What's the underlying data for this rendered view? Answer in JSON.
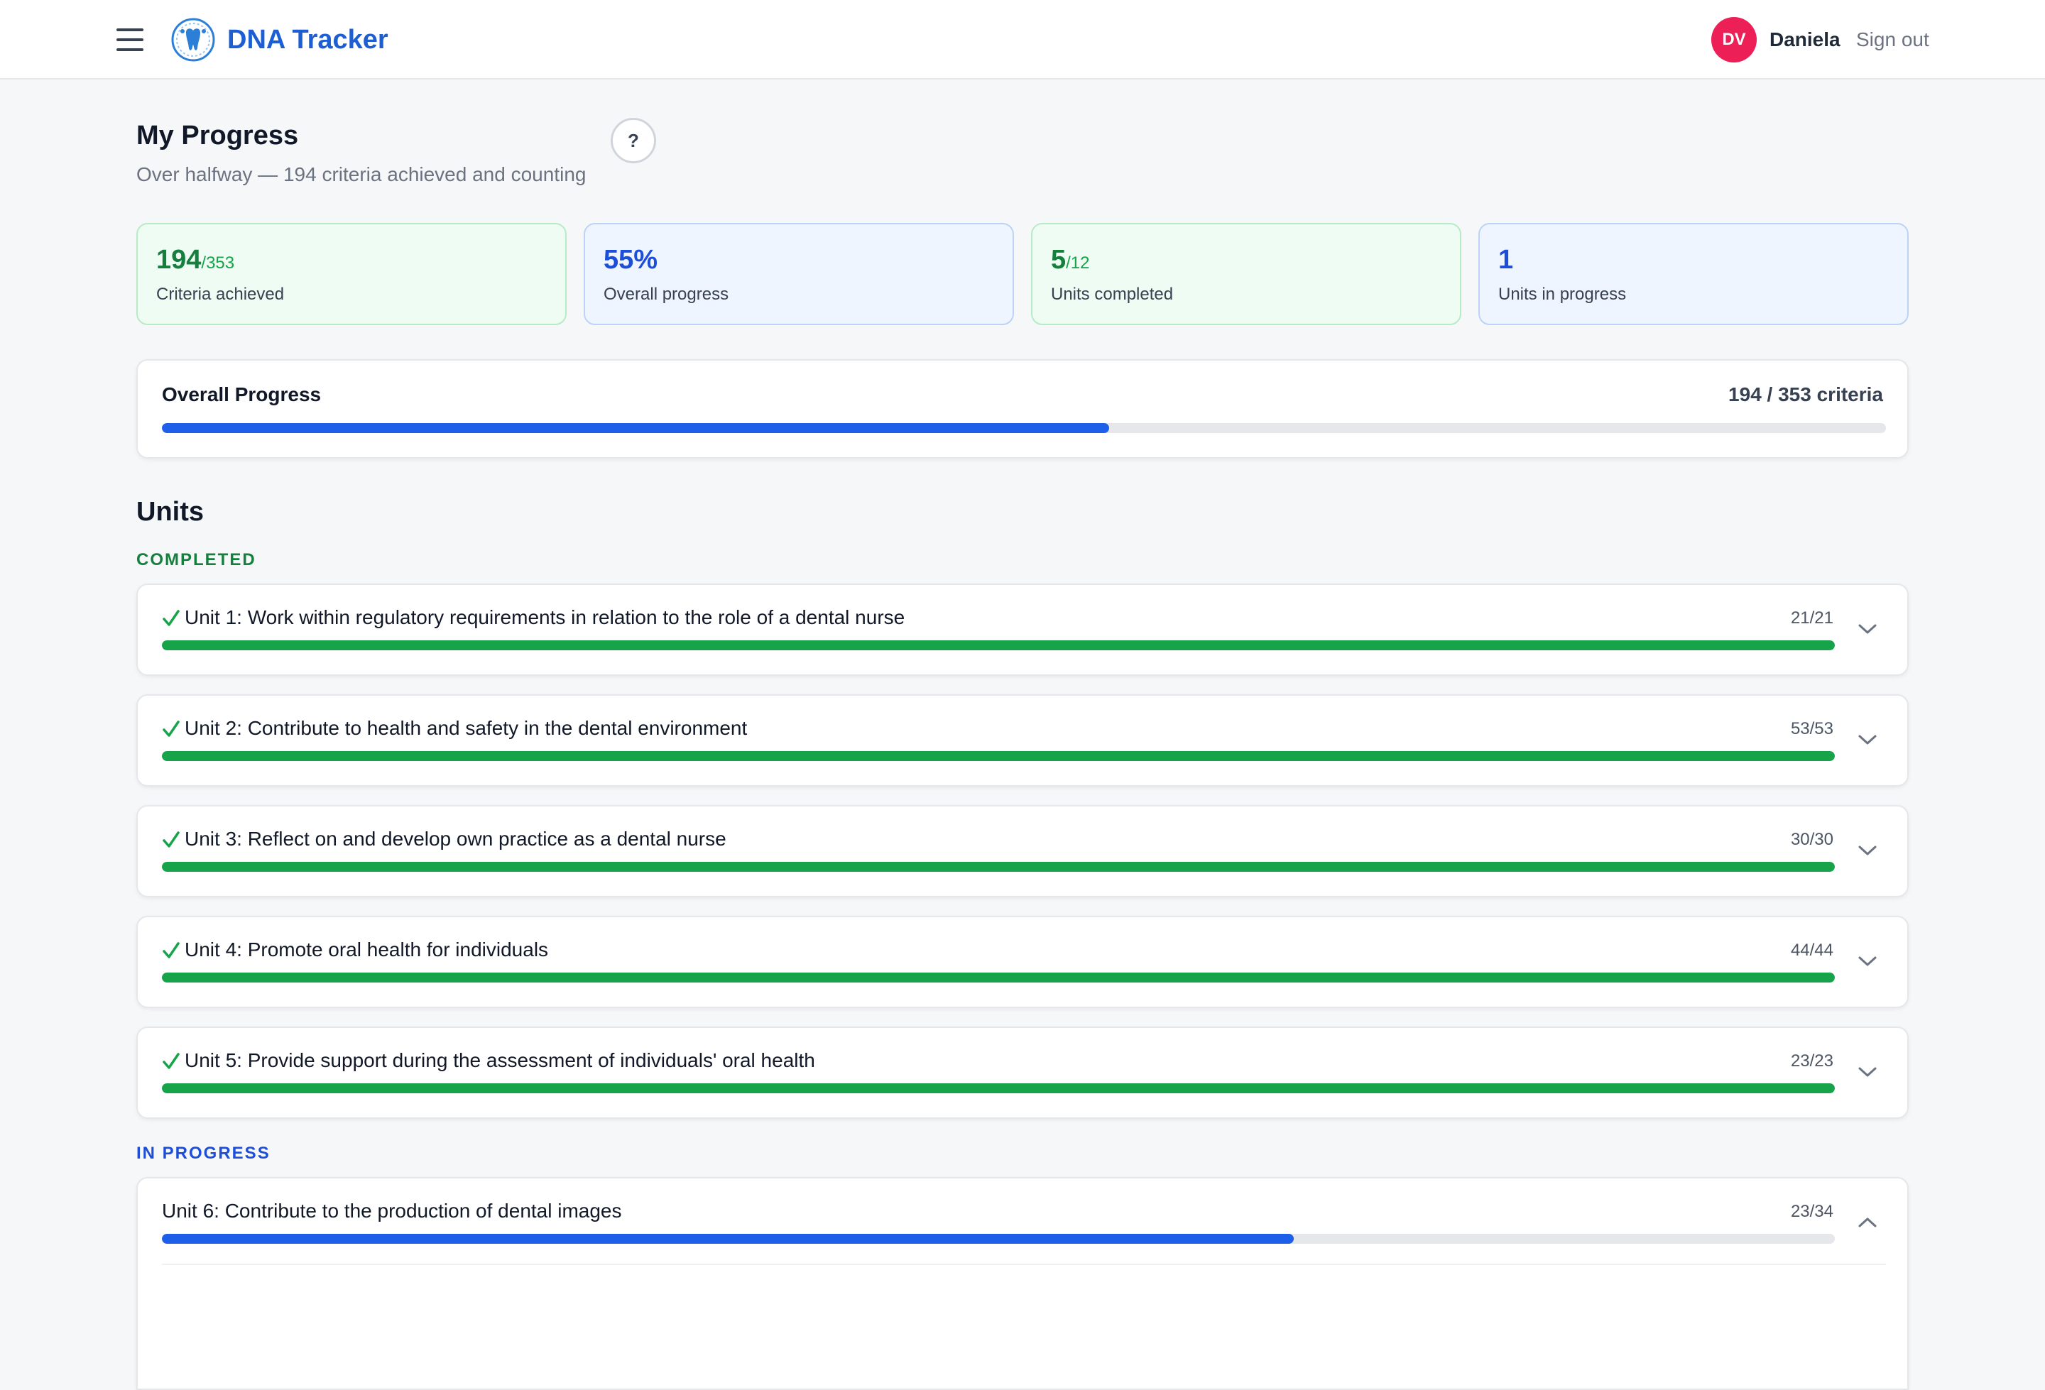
{
  "header": {
    "brand": "DNA Tracker",
    "logo_icon": "tooth-logo-icon",
    "menu_icon": "hamburger-icon",
    "user": {
      "initials": "DV",
      "name": "Daniela",
      "avatar_color": "#ec1f57"
    },
    "sign_out_label": "Sign out"
  },
  "page": {
    "title": "My Progress",
    "subtitle": "Over halfway — 194 criteria achieved and counting",
    "help_label": "?"
  },
  "stats": [
    {
      "value": "194",
      "suffix": "/353",
      "label": "Criteria achieved",
      "tone": "green"
    },
    {
      "value": "55%",
      "suffix": "",
      "label": "Overall progress",
      "tone": "blue"
    },
    {
      "value": "5",
      "suffix": "/12",
      "label": "Units completed",
      "tone": "green"
    },
    {
      "value": "1",
      "suffix": "",
      "label": "Units in progress",
      "tone": "blue"
    }
  ],
  "overall": {
    "title": "Overall Progress",
    "count_label": "194 / 353 criteria",
    "achieved": 194,
    "total": 353
  },
  "units": {
    "title": "Units",
    "completed_label": "COMPLETED",
    "in_progress_label": "IN PROGRESS",
    "completed": [
      {
        "title": "Unit 1: Work within regulatory requirements in relation to the role of a dental nurse",
        "count": "21/21",
        "done": 21,
        "total": 21
      },
      {
        "title": "Unit 2: Contribute to health and safety in the dental environment",
        "count": "53/53",
        "done": 53,
        "total": 53
      },
      {
        "title": "Unit 3: Reflect on and develop own practice as a dental nurse",
        "count": "30/30",
        "done": 30,
        "total": 30
      },
      {
        "title": "Unit 4: Promote oral health for individuals",
        "count": "44/44",
        "done": 44,
        "total": 44
      },
      {
        "title": "Unit 5: Provide support during the assessment of individuals' oral health",
        "count": "23/23",
        "done": 23,
        "total": 23
      }
    ],
    "in_progress": [
      {
        "title": "Unit 6: Contribute to the production of dental images",
        "count": "23/34",
        "done": 23,
        "total": 34
      }
    ]
  },
  "colors": {
    "brand": "#1d5fd3",
    "progress_blue": "#1d5fe8",
    "complete_green": "#16a34a",
    "avatar": "#ec1f57"
  }
}
